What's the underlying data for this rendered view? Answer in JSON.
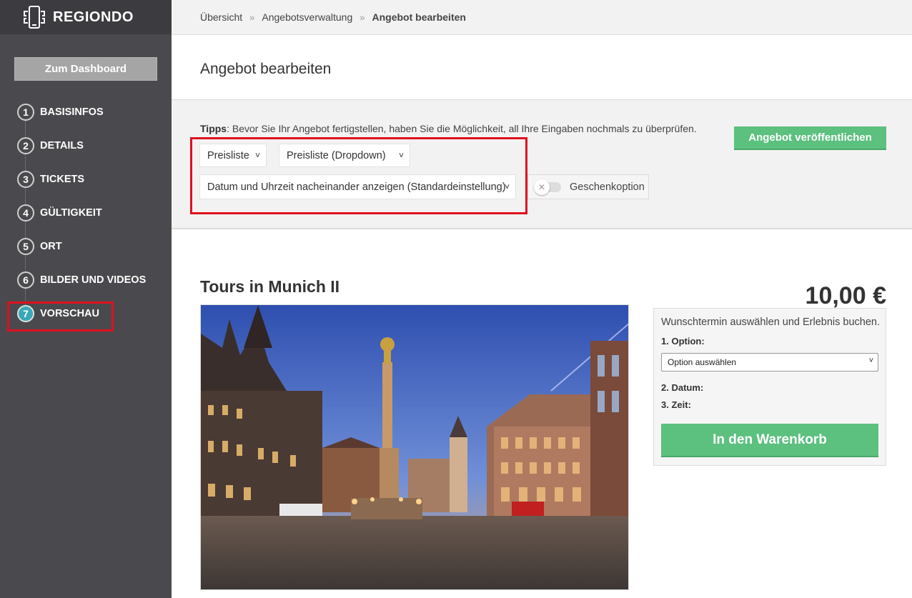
{
  "brand": {
    "name": "REGIONDO"
  },
  "sidebar": {
    "dashboard_label": "Zum Dashboard",
    "steps": [
      {
        "num": "1",
        "label": "BASISINFOS"
      },
      {
        "num": "2",
        "label": "DETAILS"
      },
      {
        "num": "3",
        "label": "TICKETS"
      },
      {
        "num": "4",
        "label": "GÜLTIGKEIT"
      },
      {
        "num": "5",
        "label": "ORT"
      },
      {
        "num": "6",
        "label": "BILDER UND VIDEOS"
      },
      {
        "num": "7",
        "label": "VORSCHAU"
      }
    ],
    "active_step": "7"
  },
  "breadcrumb": {
    "items": [
      "Übersicht",
      "Angebotsverwaltung",
      "Angebot bearbeiten"
    ],
    "separator": "»"
  },
  "page": {
    "title": "Angebot bearbeiten"
  },
  "tools": {
    "tips_label": "Tipps",
    "tips_text": ": Bevor Sie Ihr Angebot fertigstellen, haben Sie die Möglichkeit, all Ihre Eingaben nochmals zu überprüfen.",
    "publish_label": "Angebot veröffentlichen",
    "select_pricelist": "Preisliste",
    "select_pricelist_mode": "Preisliste (Dropdown)",
    "select_datetime": "Datum und Uhrzeit nacheinander anzeigen (Standardeinstellung)",
    "gift_label": "Geschenkoption",
    "gift_enabled": false
  },
  "product": {
    "title": "Tours in Munich II",
    "price": "10,00 €",
    "booking": {
      "intro": "Wunschtermin auswählen und Erlebnis buchen.",
      "option_label": "1. Option:",
      "option_placeholder": "Option auswählen",
      "date_label": "2. Datum:",
      "time_label": "3. Zeit:",
      "cart_label": "In den Warenkorb"
    }
  },
  "colors": {
    "sidebar_bg": "#4a4a4e",
    "accent_green": "#5cc07e",
    "highlight_red": "#e0101e",
    "active_step": "#3aa7b8"
  }
}
